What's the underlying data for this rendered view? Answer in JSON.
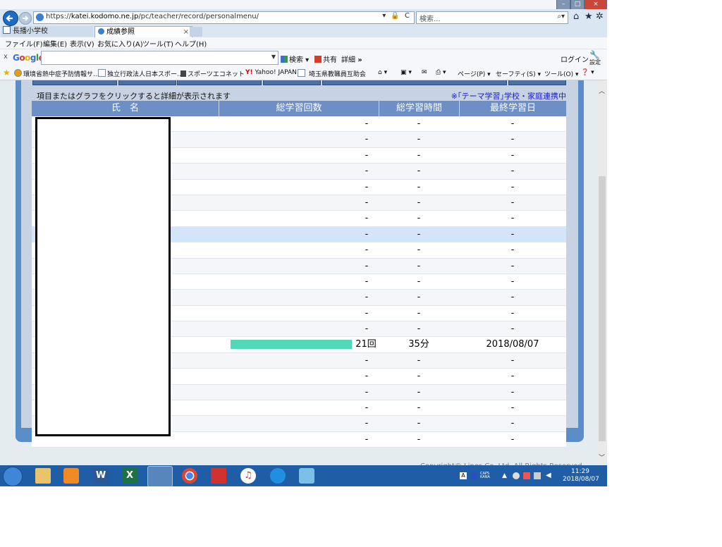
{
  "browser": {
    "url_prefix": "https://",
    "url_domain": "katei.kodomo.ne.jp",
    "url_path": "/pc/teacher/record/personalmenu/",
    "address_tools": "▾ 🔒 C",
    "search_placeholder": "検索...",
    "search_icon": "⌕▾",
    "tabs": [
      {
        "label": "長播小学校"
      },
      {
        "label": "成績参照",
        "close": "×"
      }
    ],
    "window_controls": {
      "minimize": "–",
      "maximize": "□",
      "close": "×"
    },
    "top_icons": [
      "home-icon",
      "star-icon",
      "gear-icon"
    ]
  },
  "menu": [
    "ファイル(F)",
    "編集(E)",
    "表示(V)",
    "お気に入り(A)",
    "ツール(T)",
    "ヘルプ(H)"
  ],
  "google_toolbar": {
    "close": "x",
    "logo": "Google",
    "search_button": "検索",
    "share": "共有",
    "more": "詳細",
    "more_arrow": "»",
    "login": "ログイン",
    "settings": "設定"
  },
  "favorites": {
    "items": [
      "環境省熱中症予防情報サ...",
      "独立行政法人日本スポー...",
      "スポーツエコネット",
      "Yahoo! JAPAN",
      "埼玉県教職員互助会"
    ],
    "commands": [
      "ページ(P)",
      "セーフティ(S)",
      "ツール(O)"
    ]
  },
  "page": {
    "note": "項目またはグラフをクリックすると詳細が表示されます",
    "note_link": "※｢テーマ学習｣学校・家庭連携中",
    "columns": [
      "氏　名",
      "総学習回数",
      "総学習時間",
      "最終学習日"
    ],
    "rows": [
      {
        "count": "-",
        "time": "-",
        "date": "-",
        "bar": 0
      },
      {
        "count": "-",
        "time": "-",
        "date": "-",
        "bar": 0
      },
      {
        "count": "-",
        "time": "-",
        "date": "-",
        "bar": 0
      },
      {
        "count": "-",
        "time": "-",
        "date": "-",
        "bar": 0
      },
      {
        "count": "-",
        "time": "-",
        "date": "-",
        "bar": 0
      },
      {
        "count": "-",
        "time": "-",
        "date": "-",
        "bar": 0
      },
      {
        "count": "-",
        "time": "-",
        "date": "-",
        "bar": 0
      },
      {
        "count": "-",
        "time": "-",
        "date": "-",
        "bar": 0,
        "highlight": true
      },
      {
        "count": "-",
        "time": "-",
        "date": "-",
        "bar": 0
      },
      {
        "count": "-",
        "time": "-",
        "date": "-",
        "bar": 0
      },
      {
        "count": "-",
        "time": "-",
        "date": "-",
        "bar": 0
      },
      {
        "count": "-",
        "time": "-",
        "date": "-",
        "bar": 0
      },
      {
        "count": "-",
        "time": "-",
        "date": "-",
        "bar": 0
      },
      {
        "count": "-",
        "time": "-",
        "date": "-",
        "bar": 0
      },
      {
        "count": "21回",
        "time": "35分",
        "date": "2018/08/07",
        "bar": 21
      },
      {
        "count": "-",
        "time": "-",
        "date": "-",
        "bar": 0
      },
      {
        "count": "-",
        "time": "-",
        "date": "-",
        "bar": 0
      },
      {
        "count": "-",
        "time": "-",
        "date": "-",
        "bar": 0
      },
      {
        "count": "-",
        "time": "-",
        "date": "-",
        "bar": 0
      },
      {
        "count": "-",
        "time": "-",
        "date": "-",
        "bar": 0
      },
      {
        "count": "-",
        "time": "-",
        "date": "-",
        "bar": 0
      }
    ],
    "copyright": "Copyright© Lines Co.,Ltd. All Rights Reserved.",
    "bar_color": "#52d8b8",
    "header_color": "#6d8fc6"
  },
  "taskbar": {
    "apps": [
      "explorer-icon",
      "media-player-icon",
      "word-icon",
      "excel-icon",
      "internet-explorer-icon",
      "chrome-icon",
      "app-icon",
      "itunes-icon",
      "outlook-icon",
      "tool-icon"
    ],
    "tray": {
      "ime": "A",
      "ime2": "CAPS KANA"
    },
    "time": "11:29",
    "date": "2018/08/07"
  }
}
